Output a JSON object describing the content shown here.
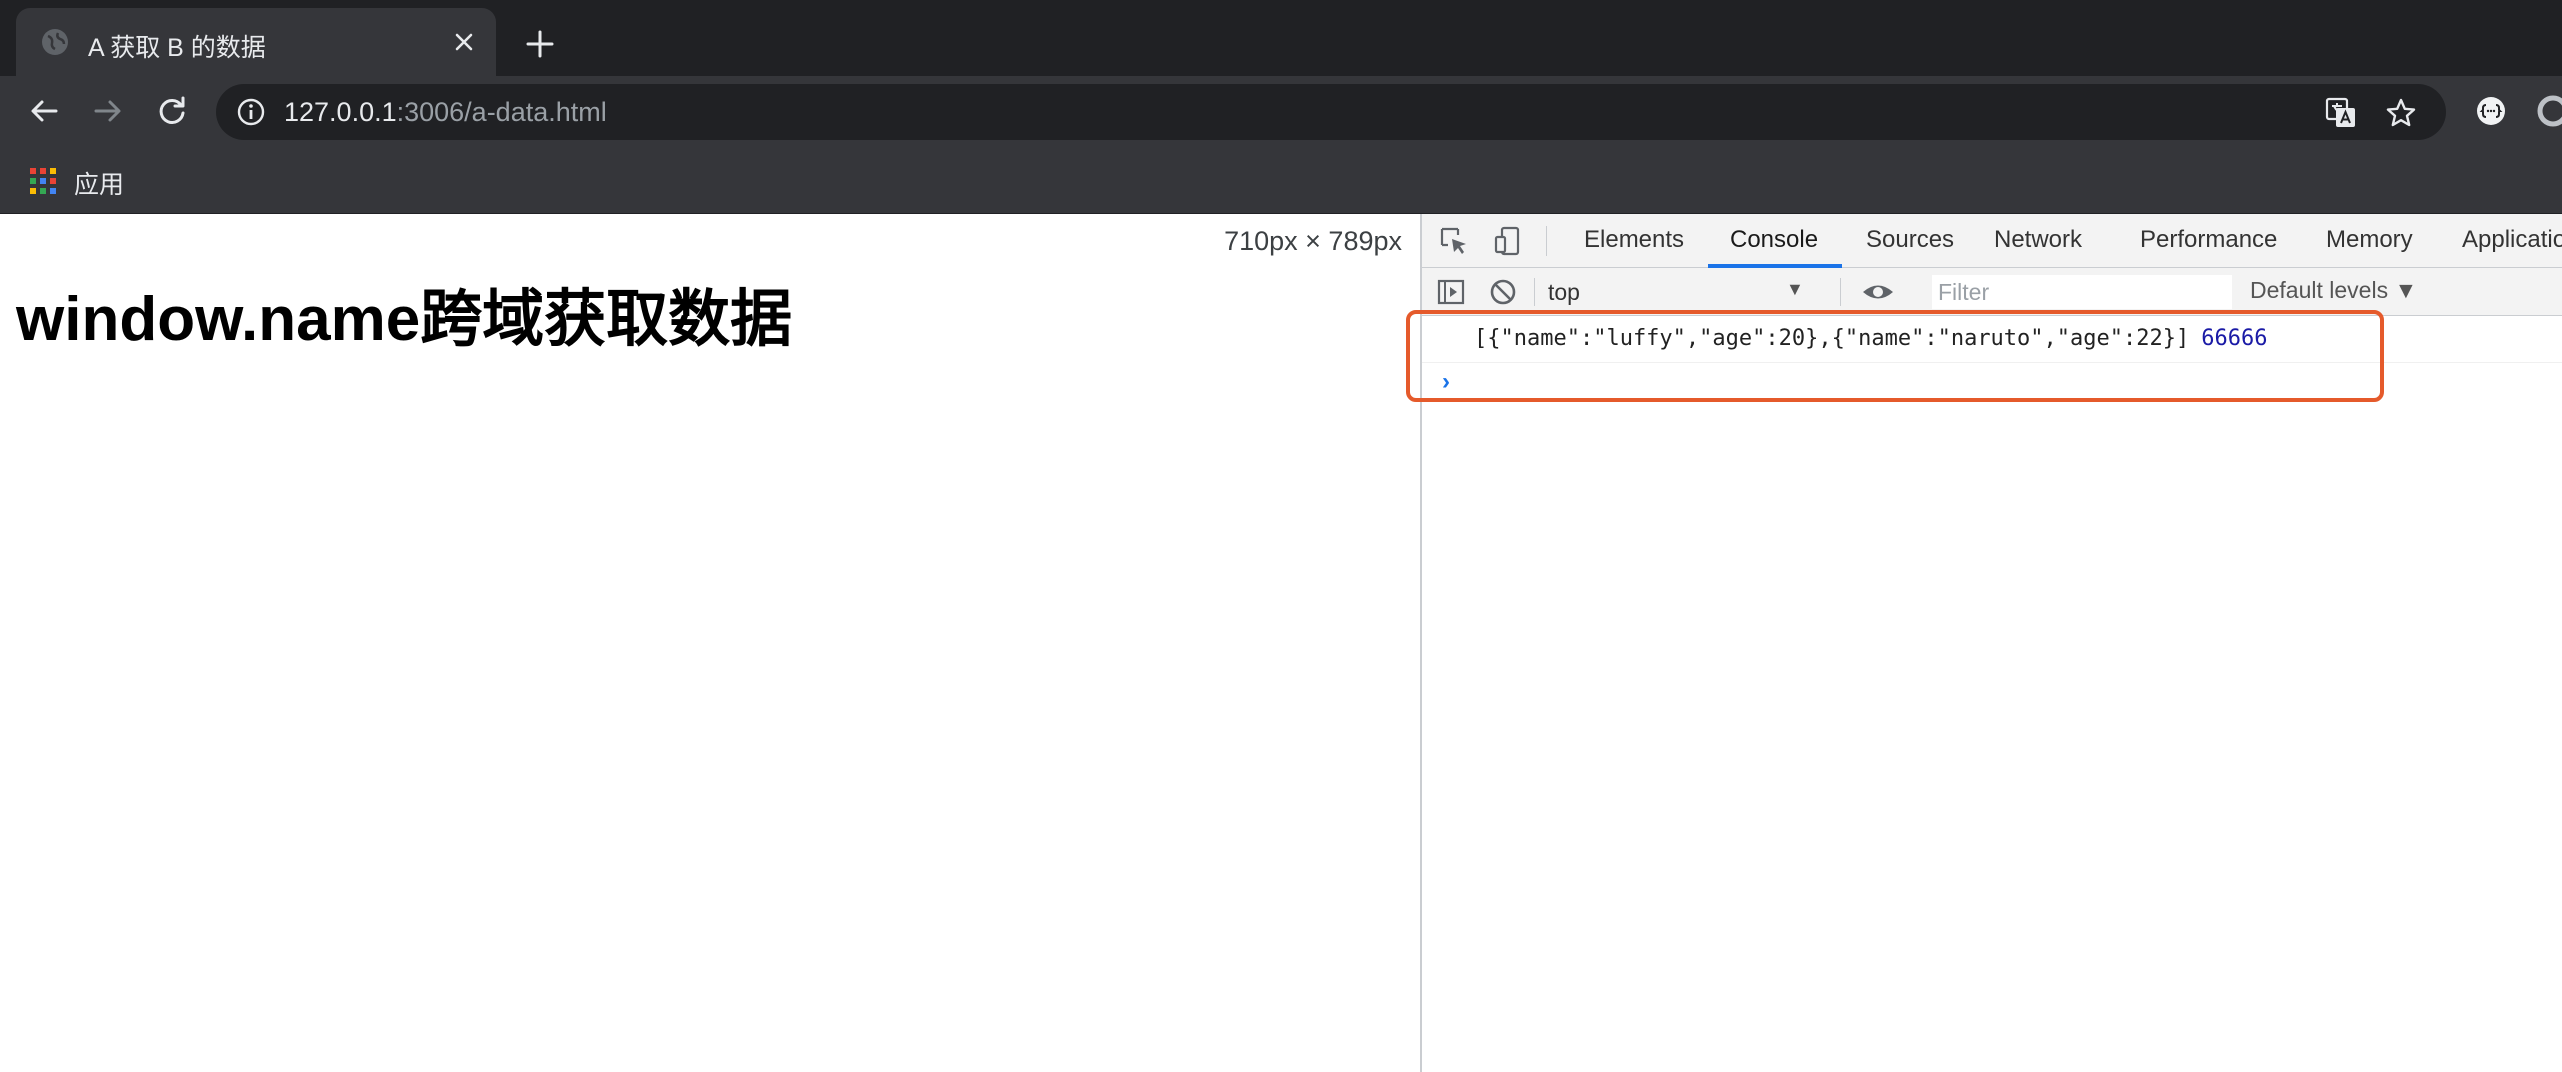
{
  "browser": {
    "tab_title": "A 获取 B 的数据",
    "url_host": "127.0.0.1",
    "url_rest": ":3006/a-data.html",
    "bookmarks": {
      "apps_label": "应用"
    }
  },
  "page": {
    "dimension_overlay": "710px × 789px",
    "heading": "window.name跨域获取数据"
  },
  "devtools": {
    "tabs": [
      {
        "label": "Elements"
      },
      {
        "label": "Console"
      },
      {
        "label": "Sources"
      },
      {
        "label": "Network"
      },
      {
        "label": "Performance"
      },
      {
        "label": "Memory"
      },
      {
        "label": "Applicatio"
      }
    ],
    "active_tab": "Console",
    "console": {
      "context": "top",
      "filter_placeholder": "Filter",
      "levels_label": "Default levels ▼",
      "log_text": "[{\"name\":\"luffy\",\"age\":20},{\"name\":\"naruto\",\"age\":22}]",
      "log_number": "66666",
      "prompt_symbol": "›"
    }
  },
  "colors": {
    "tab_strip": "#202124",
    "toolbar": "#35363a",
    "accent": "#1a73e8",
    "highlight": "#e55a2b"
  }
}
